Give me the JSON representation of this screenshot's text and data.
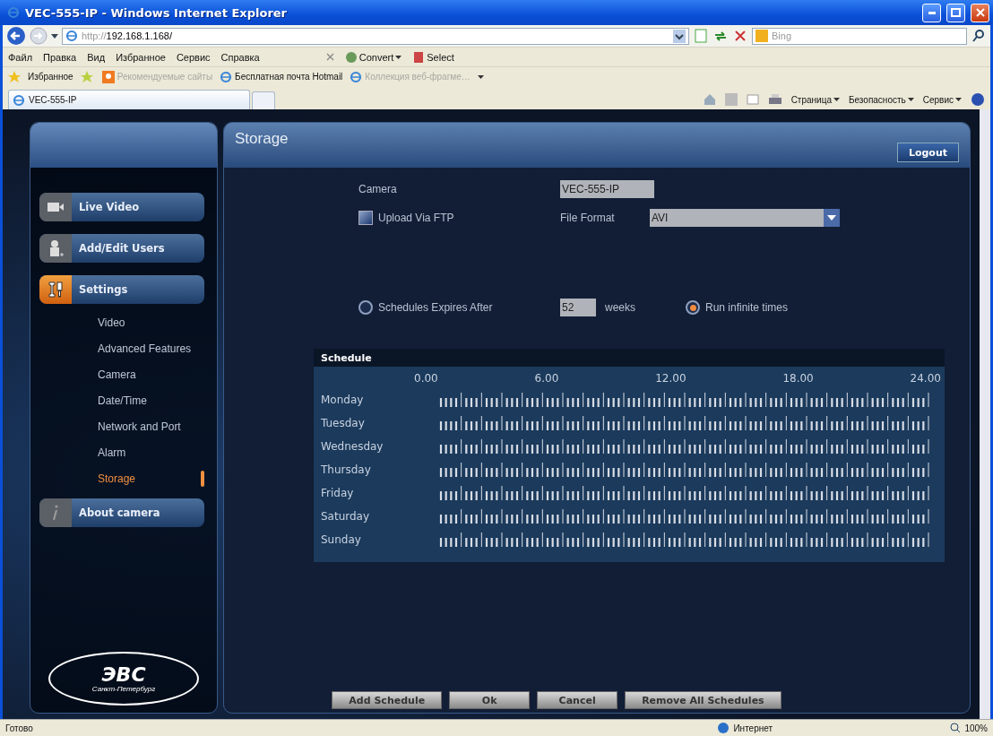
{
  "browser": {
    "title": "VEC-555-IP - Windows Internet Explorer",
    "url_prefix": "http://",
    "url_host": "192.168.1.168/",
    "search_placeholder": "Bing",
    "menu": [
      "Файл",
      "Правка",
      "Вид",
      "Избранное",
      "Сервис",
      "Справка"
    ],
    "tools": [
      {
        "label": "Convert",
        "kind": "convert"
      },
      {
        "label": "Select",
        "kind": "select"
      }
    ],
    "favorites_label": "Избранное",
    "favorites": [
      {
        "label": "Рекомендуемые сайты",
        "dimmed": true,
        "kind": "orange"
      },
      {
        "label": "Бесплатная почта Hotmail",
        "dimmed": false,
        "kind": "ie"
      },
      {
        "label": "Коллекция веб-фрагме…",
        "dimmed": true,
        "kind": "ie"
      }
    ],
    "tab": "VEC-555-IP",
    "commands": [
      "Страница",
      "Безопасность",
      "Сервис"
    ],
    "status": "Готово",
    "zone": "Интернет",
    "zoom": "100%"
  },
  "sidebar": {
    "nav": [
      {
        "label": "Live Video",
        "kind": "camera",
        "selected": false
      },
      {
        "label": "Add/Edit Users",
        "kind": "user",
        "selected": false
      },
      {
        "label": "Settings",
        "kind": "tools",
        "selected": true,
        "children": [
          {
            "label": "Video",
            "selected": false
          },
          {
            "label": "Advanced Features",
            "selected": false
          },
          {
            "label": "Camera",
            "selected": false
          },
          {
            "label": "Date/Time",
            "selected": false
          },
          {
            "label": "Network and Port",
            "selected": false
          },
          {
            "label": "Alarm",
            "selected": false
          },
          {
            "label": "Storage",
            "selected": true
          }
        ]
      },
      {
        "label": "About camera",
        "kind": "info",
        "selected": false
      }
    ],
    "logo": {
      "text": "ЭВС",
      "subtitle": "Санкт-Петербург"
    }
  },
  "page": {
    "title": "Storage",
    "logout": "Logout",
    "camera_label": "Camera",
    "camera_value": "VEC-555-IP",
    "upload": {
      "label": "Upload Via FTP",
      "checked": false
    },
    "file_format": {
      "label": "File Format",
      "value": "AVI"
    },
    "expiry": [
      {
        "label": "Schedules Expires After",
        "selected": false
      },
      {
        "label": "Run infinite times",
        "selected": true
      }
    ],
    "weeks_value": "52",
    "weeks_unit": "weeks",
    "schedule": {
      "title": "Schedule",
      "times": [
        "0.00",
        "6.00",
        "12.00",
        "18.00",
        "24.00"
      ],
      "days": [
        "Monday",
        "Tuesday",
        "Wednesday",
        "Thursday",
        "Friday",
        "Saturday",
        "Sunday"
      ]
    },
    "buttons": [
      "Add Schedule",
      "Ok",
      "Cancel",
      "Remove All Schedules"
    ]
  }
}
